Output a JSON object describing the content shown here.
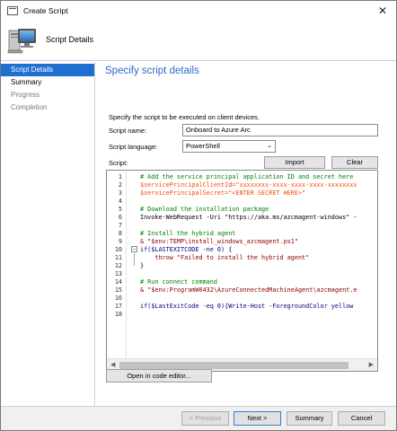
{
  "window": {
    "title": "Create Script",
    "close_glyph": "✕"
  },
  "header": {
    "title": "Script Details",
    "icon": "computer-script-icon"
  },
  "nav": {
    "items": [
      {
        "label": "Script Details",
        "state": "active"
      },
      {
        "label": "Summary",
        "state": "normal"
      },
      {
        "label": "Progress",
        "state": "disabled"
      },
      {
        "label": "Completion",
        "state": "disabled"
      }
    ]
  },
  "page": {
    "heading": "Specify script details",
    "instruction": "Specify the script to be executed on client devices.",
    "name_label": "Script name:",
    "name_value": "Onboard to Azure Arc",
    "language_label": "Script language:",
    "language_value": "PowerShell",
    "script_label": "Script:",
    "import_label": "Import",
    "clear_label": "Clear",
    "code_editor_label": "Open in code editor..."
  },
  "script": {
    "line_numbers": [
      "1",
      "2",
      "3",
      "4",
      "5",
      "6",
      "7",
      "8",
      "9",
      "10",
      "11",
      "12",
      "13",
      "14",
      "15",
      "16",
      "17",
      "18"
    ],
    "lines": [
      "# Add the service principal application ID and secret here",
      "$servicePrincipalClientId=\"xxxxxxxx-xxxx-xxxx-xxxx-xxxxxxxx",
      "$servicePrincipalSecret=\"<ENTER SECRET HERE>\"",
      "",
      "# Download the installation package",
      "Invoke-WebRequest -Uri \"https://aka.ms/azcmagent-windows\" -",
      "",
      "# Install the hybrid agent",
      "& \"$env:TEMP\\install_windows_azcmagent.ps1\"",
      "if($LASTEXITCODE -ne 0) {",
      "    throw \"Failed to install the hybrid agent\"",
      "}",
      "",
      "# Run connect command",
      "& \"$env:ProgramW6432\\AzureConnectedMachineAgent\\azcmagent.e",
      "",
      "if($LastExitCode -eq 0){Write-Host -ForegroundColor yellow",
      ""
    ]
  },
  "footer": {
    "previous_label": "< Previous",
    "next_label": "Next >",
    "summary_label": "Summary",
    "cancel_label": "Cancel"
  },
  "colors": {
    "accent": "#1e6fd0",
    "heading": "#2b6bc7",
    "comment": "#008000",
    "variable": "#ff4500",
    "string": "#8b0000",
    "command": "#0000ff"
  }
}
